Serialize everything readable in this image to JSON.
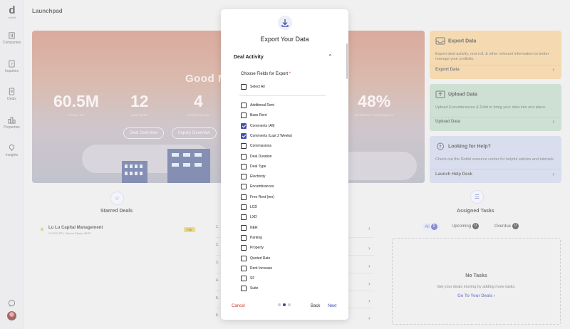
{
  "app": {
    "title": "Launchpad",
    "logo_letter": "d",
    "logo_caption": "dottid"
  },
  "sidebar": {
    "items": [
      {
        "label": "Companies",
        "icon": "building-icon"
      },
      {
        "label": "Inquiries",
        "icon": "question-box-icon"
      },
      {
        "label": "Deals",
        "icon": "document-icon"
      },
      {
        "label": "Properties",
        "icon": "city-icon"
      },
      {
        "label": "Insights",
        "icon": "lightbulb-icon"
      }
    ],
    "bottom_icon": "chat-icon"
  },
  "hero": {
    "greeting": "Good M",
    "stats": [
      {
        "value": "60.5M",
        "caption": "TOTAL SF"
      },
      {
        "value": "12",
        "caption": "MARKETS"
      },
      {
        "value": "4",
        "caption": "PORTFOLIOS"
      },
      {
        "value": "48%",
        "caption": "CURRENT OCCUPANCY"
      }
    ],
    "buttons": [
      "Deal Overview",
      "Inquiry Overview"
    ]
  },
  "cards": [
    {
      "title": "Export Data",
      "icon": "inbox-icon",
      "desc": "Export deal activity, rent roll, & other relevant information to better manage your portfolio.",
      "link": "Export Data",
      "color": "#f1c98c"
    },
    {
      "title": "Upload Data",
      "icon": "upload-icon",
      "desc": "Upload Encumbrances & Debt to bring your data into one place.",
      "link": "Upload Data",
      "color": "#b6d2bf"
    },
    {
      "title": "Looking for Help?",
      "icon": "help-icon",
      "desc": "Check out the Dottid resource center for helpful articles and tutorials.",
      "link": "Launch Help Desk",
      "color": "#c7cee6"
    }
  ],
  "starred": {
    "title": "Starred Deals",
    "deal": {
      "name": "Lu Lu Capital Management",
      "sub": "CLOCS SF | Clarion Plaza | IRGC",
      "tag": "Fair"
    }
  },
  "middle_list": [
    "1.",
    "2.",
    "3.",
    "4.",
    "5.",
    "6."
  ],
  "tasks": {
    "title": "Assigned Tasks",
    "tabs": [
      {
        "label": "All",
        "count": "0"
      },
      {
        "label": "Upcoming",
        "count": "0"
      },
      {
        "label": "Overdue",
        "count": "0"
      }
    ],
    "empty_title": "No Tasks",
    "empty_sub": "Get your deals moving by adding more tasks.",
    "empty_link": "Go To Your Deals"
  },
  "modal": {
    "title": "Export Your Data",
    "section": "Deal Activity",
    "fields_label": "Choose Fields for Export",
    "required_mark": "*",
    "select_all": "Select All",
    "options": [
      {
        "label": "Additional Rent",
        "checked": false
      },
      {
        "label": "Base Rent",
        "checked": false
      },
      {
        "label": "Comments (All)",
        "checked": true
      },
      {
        "label": "Comments (Last 2 Weeks)",
        "checked": true
      },
      {
        "label": "Commissions",
        "checked": false
      },
      {
        "label": "Deal Duration",
        "checked": false
      },
      {
        "label": "Deal Type",
        "checked": false
      },
      {
        "label": "Electricity",
        "checked": false
      },
      {
        "label": "Encumbrances",
        "checked": false
      },
      {
        "label": "Free Rent (mo)",
        "checked": false
      },
      {
        "label": "LCD",
        "checked": false
      },
      {
        "label": "LXD",
        "checked": false
      },
      {
        "label": "NER",
        "checked": false
      },
      {
        "label": "Parking",
        "checked": false
      },
      {
        "label": "Property",
        "checked": false
      },
      {
        "label": "Quoted Rate",
        "checked": false
      },
      {
        "label": "Rent Increase",
        "checked": false
      },
      {
        "label": "SF",
        "checked": false
      },
      {
        "label": "Suite",
        "checked": false
      }
    ],
    "step": 2,
    "steps_total": 3,
    "cancel": "Cancel",
    "back": "Back",
    "next": "Next"
  },
  "colors": {
    "accent": "#3b45a8",
    "cancel": "#c0392b"
  }
}
